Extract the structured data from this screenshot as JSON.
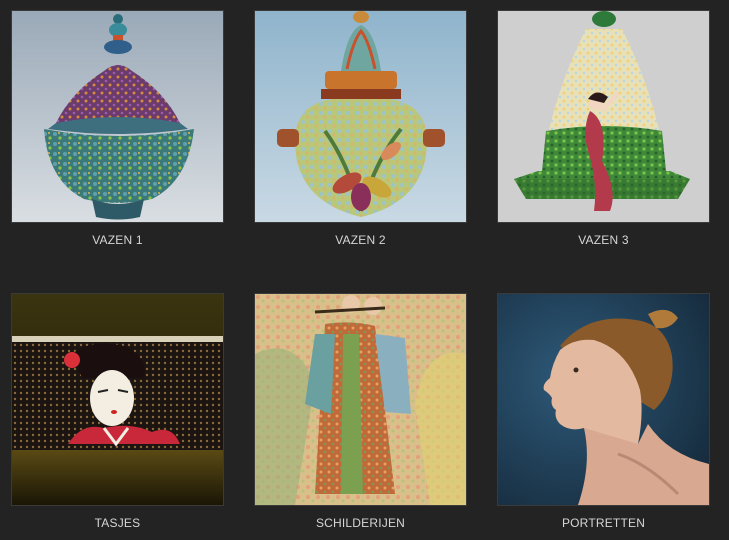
{
  "gallery": {
    "items": [
      {
        "caption": "VAZEN 1"
      },
      {
        "caption": "VAZEN 2"
      },
      {
        "caption": "VAZEN 3"
      },
      {
        "caption": "TASJES"
      },
      {
        "caption": "SCHILDERIJEN"
      },
      {
        "caption": "PORTRETTEN"
      }
    ]
  },
  "colors": {
    "page_background": "#232323",
    "caption_text": "#d6d6d6",
    "thumb_border": "#3a3a3a"
  }
}
